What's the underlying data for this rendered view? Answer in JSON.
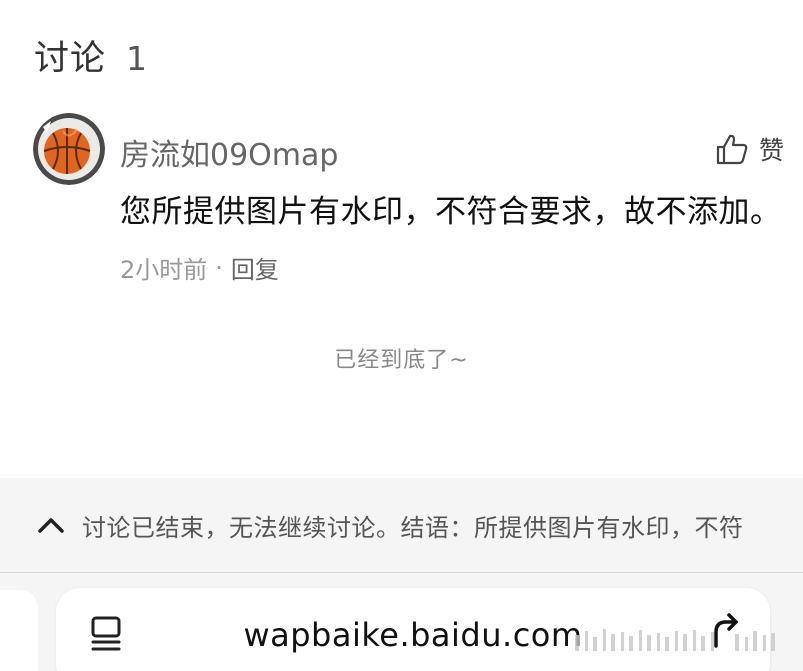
{
  "discussion": {
    "title": "讨论",
    "count": "1"
  },
  "comment": {
    "username": "房流如09Omap",
    "text": "您所提供图片有水印，不符合要求，故不添加。",
    "time": "2小时前",
    "separator": "·",
    "reply_label": "回复",
    "like_label": "赞"
  },
  "end_note": "已经到底了~",
  "closed_bar": {
    "text": "讨论已结束，无法继续讨论。结语：所提供图片有水印，不符"
  },
  "browser": {
    "url": "wapbaike.baidu.com"
  },
  "icons": {
    "avatar": "basketball-avatar",
    "like": "thumbs-up-icon",
    "collapse": "chevron-up-icon",
    "reader": "reader-mode-icon",
    "share": "share-arrow-icon"
  },
  "colors": {
    "background": "#ffffff",
    "bottom_zone": "#f5f5f5",
    "muted_text": "#999999"
  }
}
